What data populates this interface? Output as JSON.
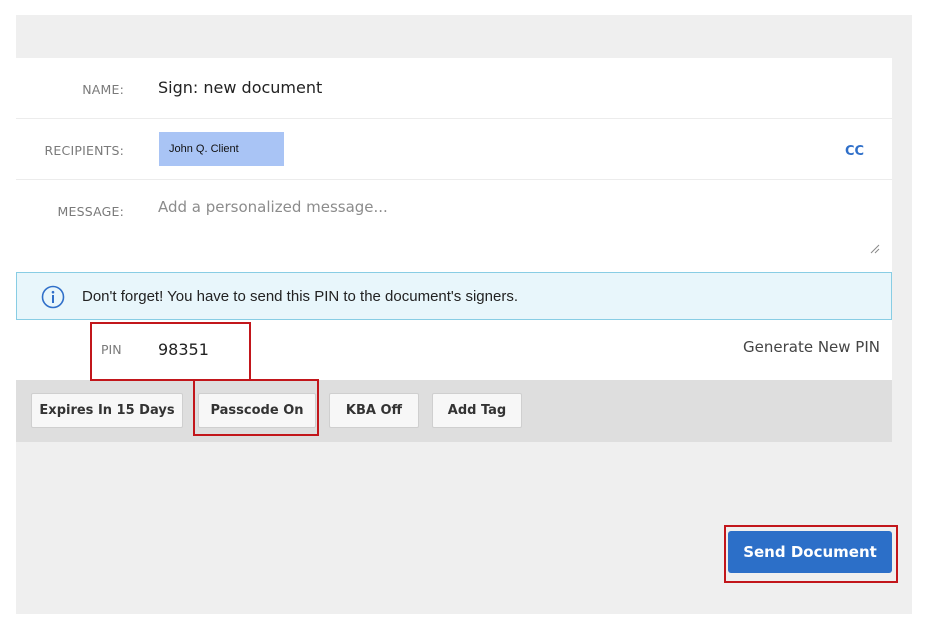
{
  "form": {
    "name_label": "NAME:",
    "name_value": "Sign: new document",
    "recipients_label": "RECIPIENTS:",
    "recipient_chip": "John Q. Client",
    "cc_label": "CC",
    "message_label": "MESSAGE:",
    "message_placeholder": "Add a personalized message..."
  },
  "notice": {
    "icon": "info-icon",
    "text": "Don't forget! You have to send this PIN to the document's signers."
  },
  "pin": {
    "label": "PIN",
    "value": "98351",
    "generate_label": "Generate New PIN"
  },
  "toolbar": {
    "expires_label": "Expires In 15 Days",
    "passcode_label": "Passcode On",
    "kba_label": "KBA Off",
    "add_tag_label": "Add Tag"
  },
  "actions": {
    "send_label": "Send Document"
  },
  "colors": {
    "accent": "#2c6fc8",
    "highlight": "#c2161b",
    "chip": "#a9c4f5",
    "notice_bg": "#e8f6fb"
  }
}
